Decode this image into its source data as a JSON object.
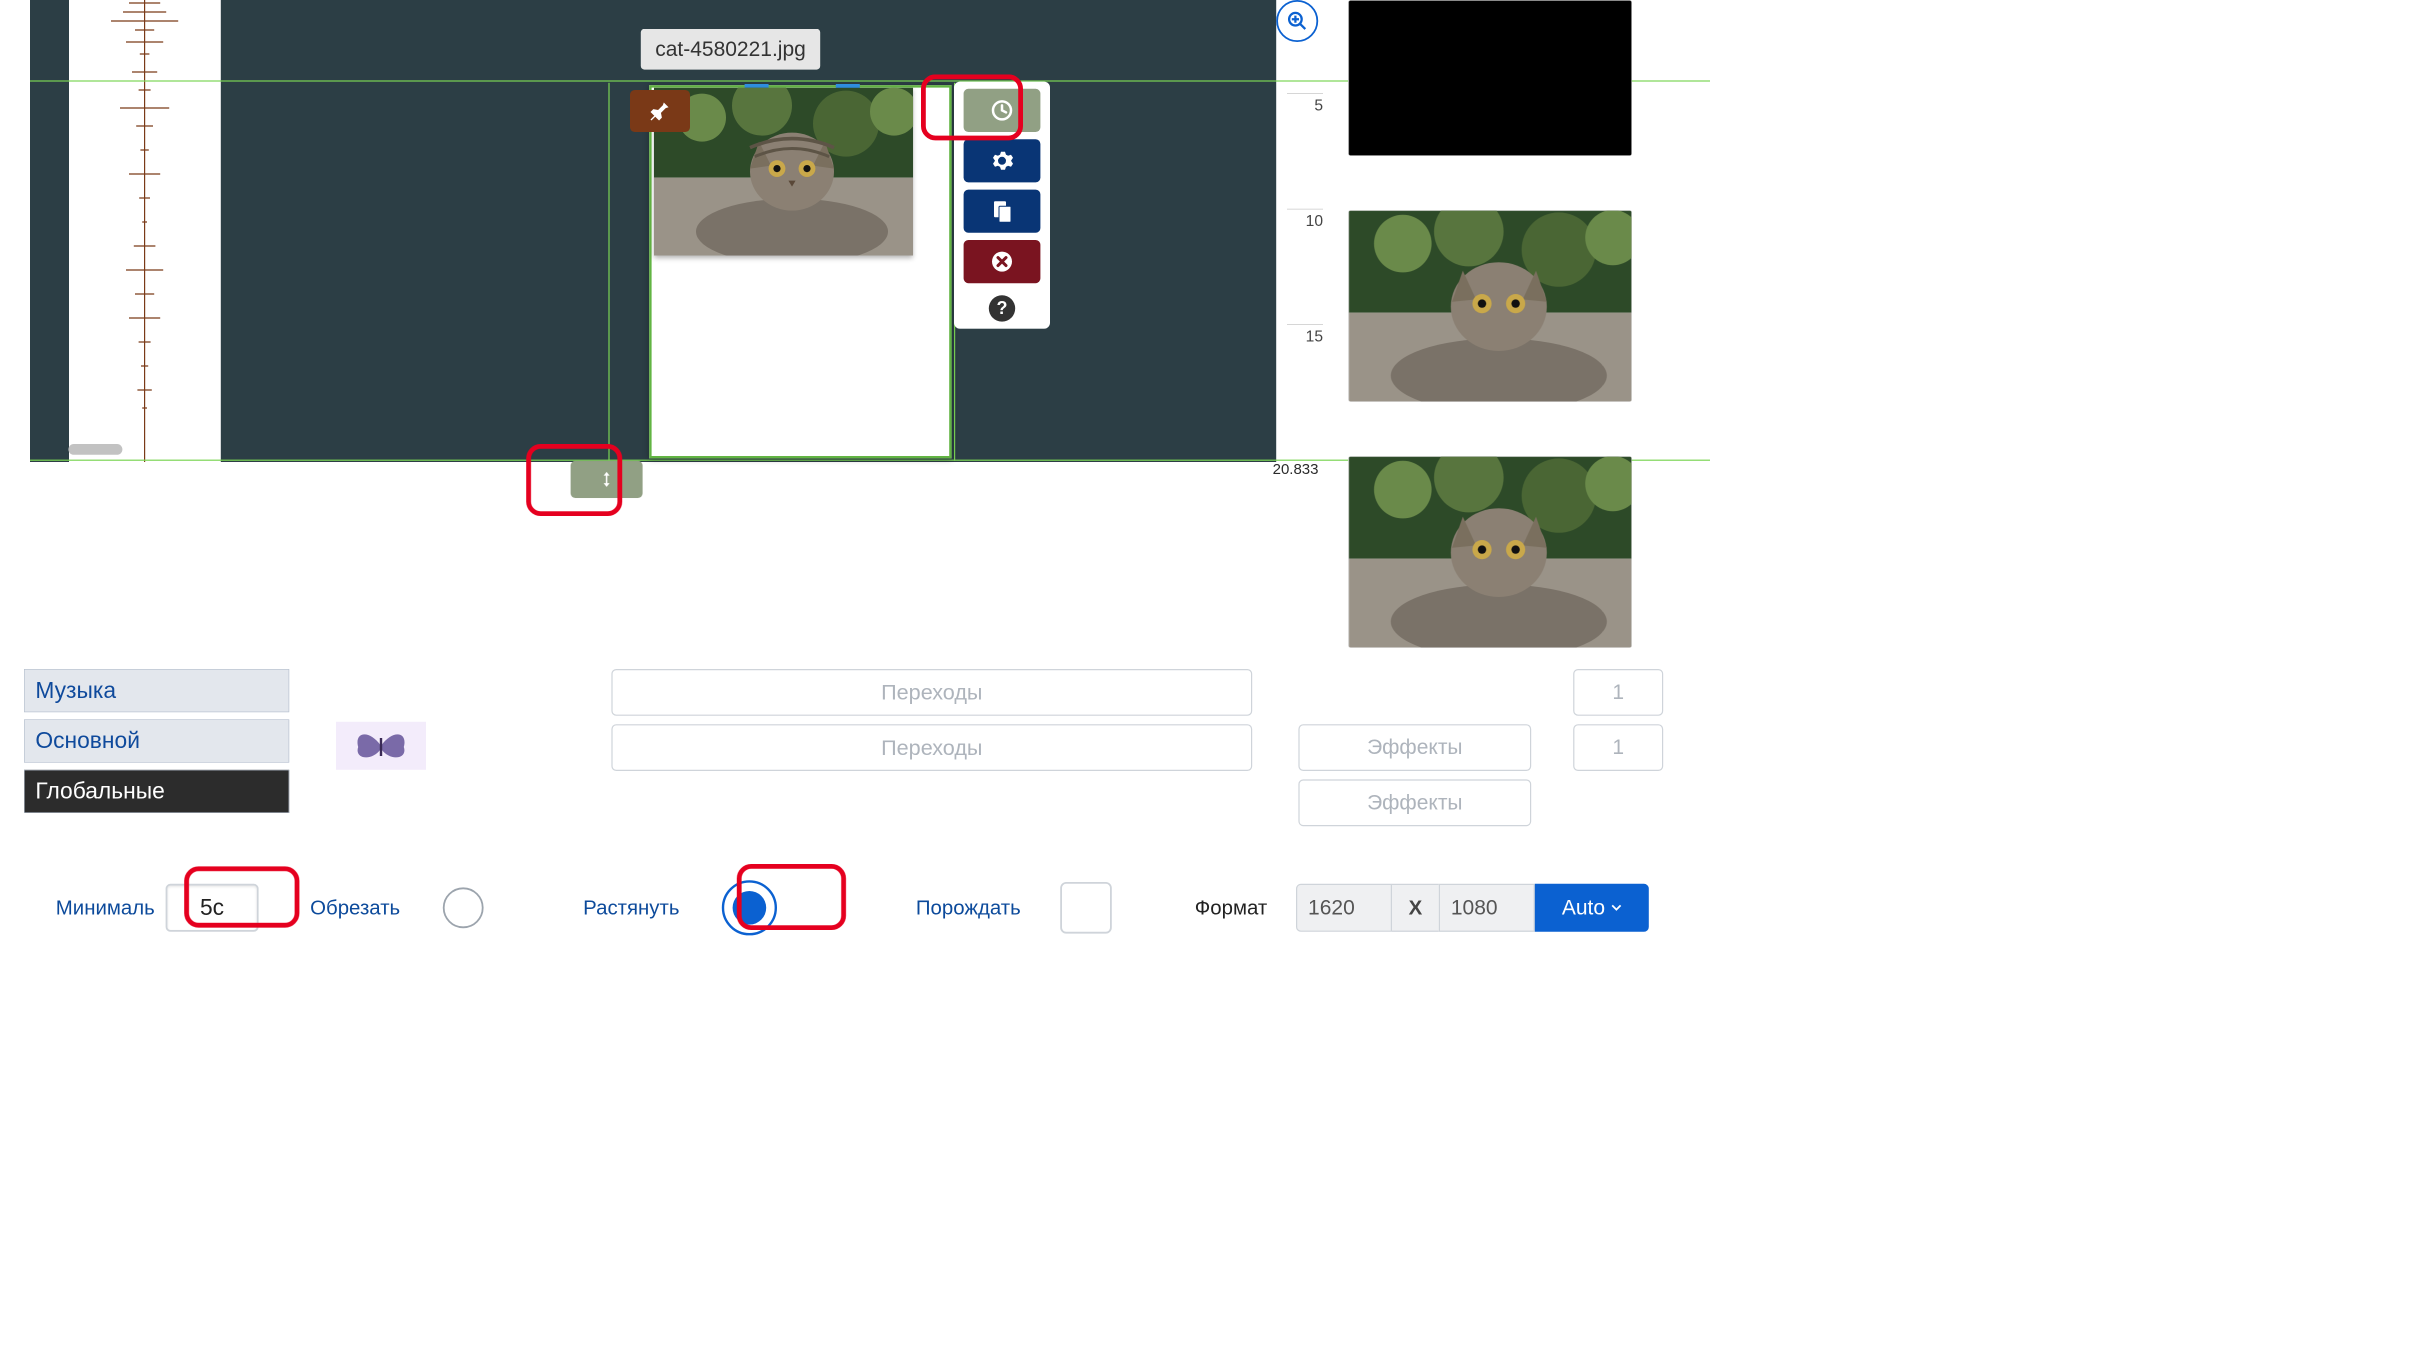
{
  "filename": "cat-4580221.jpg",
  "time_marks": {
    "m5": "5",
    "m10": "10",
    "m15": "15",
    "end": "20.833"
  },
  "toolbar": {
    "pin": "pin",
    "clock": "duration",
    "settings": "settings",
    "copy": "copy",
    "delete": "delete",
    "help": "?"
  },
  "footer": {
    "layers": {
      "music": "Музыка",
      "main": "Основной",
      "global": "Глобальные"
    },
    "transitions": "Переходы",
    "effects": "Эффекты",
    "count1": "1",
    "count2": "1",
    "min_label": "Минималь",
    "min_value": "5с",
    "crop": "Обрезать",
    "stretch": "Растянуть",
    "spawn": "Порождать",
    "format": "Формат",
    "width": "1620",
    "x": "X",
    "height": "1080",
    "auto": "Auto"
  }
}
